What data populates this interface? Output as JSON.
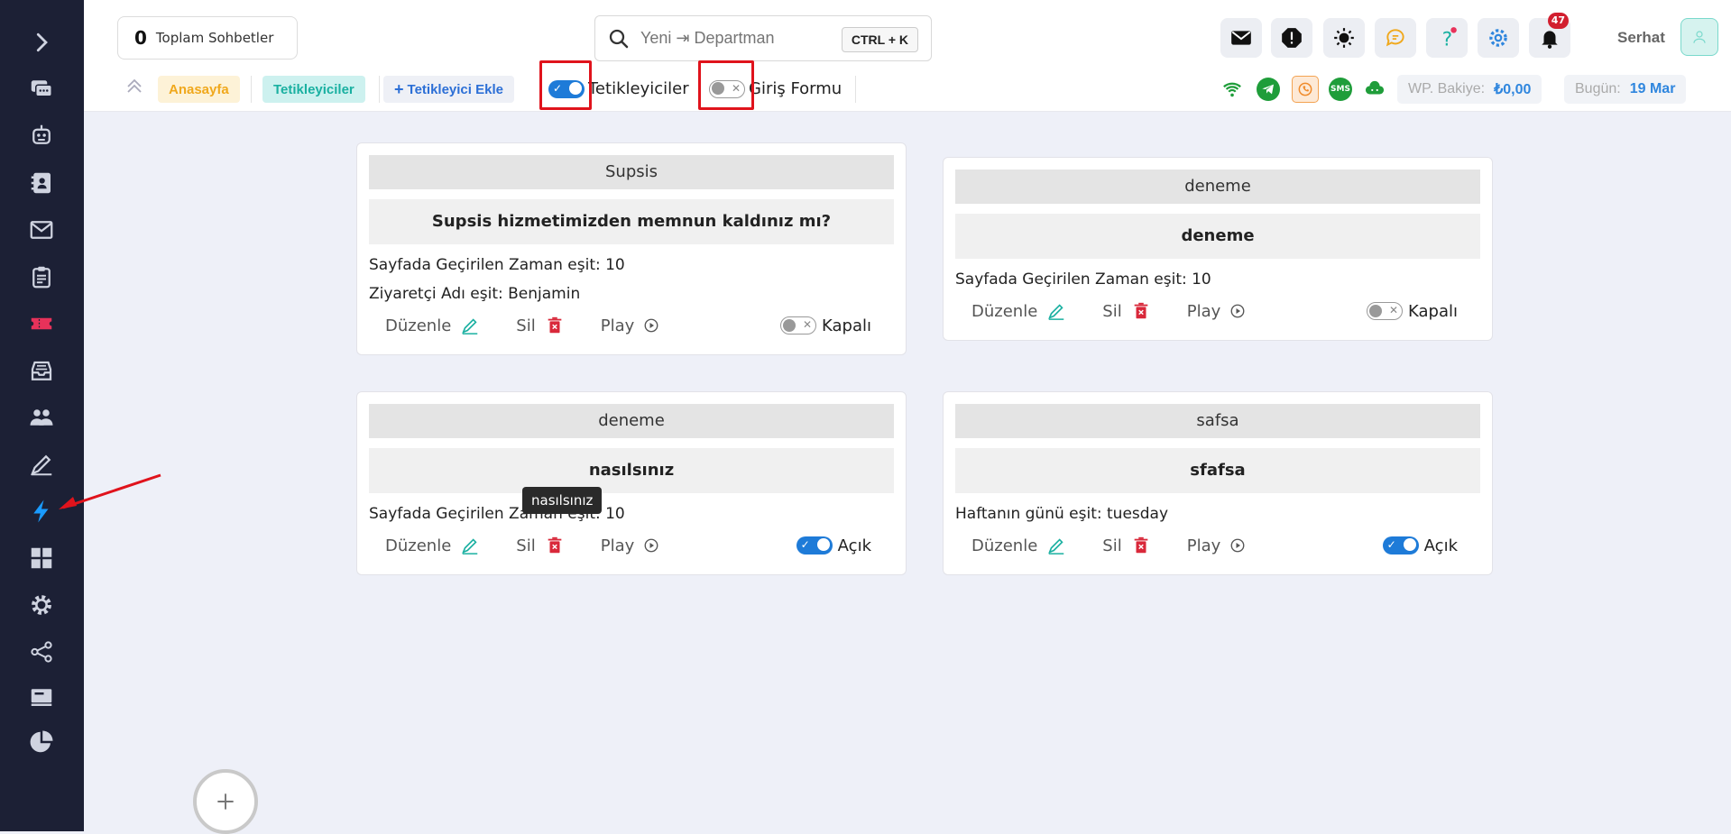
{
  "header": {
    "total_count": "0",
    "total_label": "Toplam Sohbetler",
    "search_placeholder": "Yeni ⇥ Departman",
    "search_shortcut": "CTRL + K",
    "notification_count": "47",
    "user_name": "Serhat"
  },
  "toolbar": {
    "home_label": "Anasayfa",
    "triggers_label": "Tetikleyiciler",
    "add_trigger_label": "Tetikleyici Ekle",
    "toggle_triggers_label": "Tetikleyiciler",
    "toggle_login_label": "Giriş Formu",
    "sms_label": "SMS",
    "balance_label": "WP. Bakiye:",
    "balance_value": "₺0,00",
    "today_label": "Bugün:",
    "today_value": "19 Mar"
  },
  "cards": [
    {
      "caption": "Supsis",
      "title": "Supsis hizmetimizden memnun kaldınız mı?",
      "conditions": [
        "Sayfada Geçirilen Zaman eşit: 10",
        "Ziyaretçi Adı eşit: Benjamin"
      ],
      "edit_label": "Düzenle",
      "delete_label": "Sil",
      "play_label": "Play",
      "status_label": "Kapalı",
      "enabled": false
    },
    {
      "caption": "deneme",
      "title": "deneme",
      "conditions": [
        "Sayfada Geçirilen Zaman eşit: 10"
      ],
      "edit_label": "Düzenle",
      "delete_label": "Sil",
      "play_label": "Play",
      "status_label": "Kapalı",
      "enabled": false
    },
    {
      "caption": "deneme",
      "title": "nasılsınız",
      "conditions": [
        "Sayfada Geçirilen Zaman eşit: 10"
      ],
      "edit_label": "Düzenle",
      "delete_label": "Sil",
      "play_label": "Play",
      "status_label": "Açık",
      "enabled": true
    },
    {
      "caption": "safsa",
      "title": "sfafsa",
      "conditions": [
        "Haftanın günü eşit: tuesday"
      ],
      "edit_label": "Düzenle",
      "delete_label": "Sil",
      "play_label": "Play",
      "status_label": "Açık",
      "enabled": true
    }
  ],
  "tooltip": "nasılsınız",
  "colors": {
    "sidebar_bg": "#1c2035",
    "active_icon": "#1a9bff",
    "accent_blue": "#1e7bd8",
    "delete_red": "#d9283a",
    "edit_teal": "#1ab0a1",
    "annotation_red": "#e0131c"
  }
}
